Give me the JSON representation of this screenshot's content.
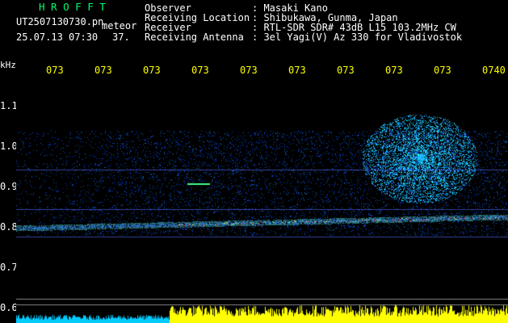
{
  "header": {
    "brand": "H R O F F T",
    "filename": "UT2507130730.pn",
    "mode": "meteor",
    "timestamp": "25.07.13 07:30",
    "count": "37.",
    "observer_label": "Observer",
    "observer_value": ": Masaki Kano",
    "location_label": "Receiving Location",
    "location_value": ": Shibukawa, Gunma, Japan",
    "receiver_label": "Receiver",
    "receiver_value": ": RTL-SDR SDR# 43dB L15 103.2MHz CW",
    "antenna_label": "Receiving Antenna",
    "antenna_value": ": 3el Yagi(V) Az 330 for Vladivostok"
  },
  "y_axis": {
    "unit": "kHz",
    "ticks": [
      "1.1",
      "1.0",
      "0.9",
      "0.8",
      "0.7",
      "0.6"
    ]
  },
  "x_axis": {
    "ticks": [
      "073",
      "073",
      "073",
      "073",
      "073",
      "073",
      "073",
      "073",
      "073",
      "0740"
    ]
  },
  "colors": {
    "background": "#000000",
    "brand": "#00ff70",
    "labels": "#ffffff",
    "time_ticks": "#ffff00",
    "noise_floor": "#1530ff",
    "signal": "#ff3030",
    "level_bar_left": "#00ccff",
    "level_bar_right": "#ffff00"
  }
}
